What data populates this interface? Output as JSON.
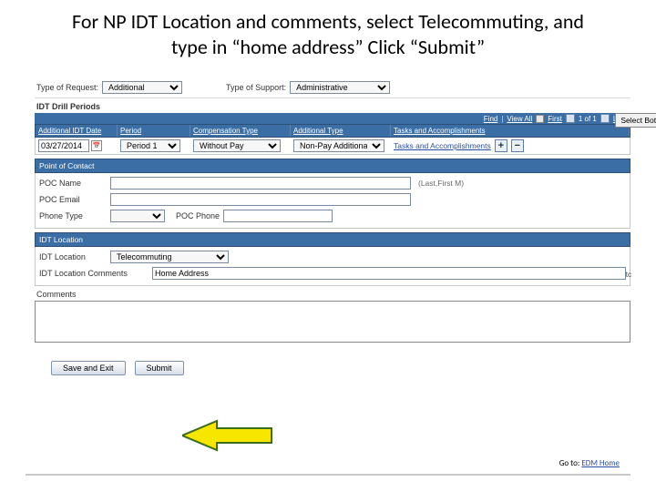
{
  "title": "For NP IDT Location and comments, select Telecommuting, and type in “home address” Click “Submit”",
  "top": {
    "type_of_request_label": "Type of Request:",
    "type_of_request_value": "Additional",
    "type_of_support_label": "Type of Support:",
    "type_of_support_value": "Administrative"
  },
  "idt_periods_title": "IDT Drill Periods",
  "findbar": {
    "find": "Find",
    "view_all": "View All",
    "first": "First",
    "count": "1 of 1",
    "last": "Last"
  },
  "select_periods_btn": "Select Both Periods",
  "columns": {
    "date": "Additional IDT Date",
    "period": "Period",
    "comp": "Compensation Type",
    "addl": "Additional Type",
    "tasks": "Tasks and Accomplishments"
  },
  "row": {
    "date": "03/27/2014",
    "period": "Period 1",
    "comp": "Without Pay",
    "addl": "Non-Pay Additional",
    "tasks_link": "Tasks and Accomplishments"
  },
  "poc": {
    "header": "Point of Contact",
    "name_label": "POC Name",
    "name_hint": "(Last,First M)",
    "email_label": "POC Email",
    "phone_type_label": "Phone Type",
    "phone_label": "POC Phone"
  },
  "loc": {
    "header": "IDT Location",
    "loc_label": "IDT Location",
    "loc_value": "Telecommuting",
    "comments_label": "IDT Location Comments",
    "comments_value": "Home Address",
    "tc_ghost": "tc"
  },
  "comments_label": "Comments",
  "buttons": {
    "save": "Save and Exit",
    "submit": "Submit"
  },
  "goto": {
    "label": "Go to:",
    "link": "EDM Home"
  }
}
